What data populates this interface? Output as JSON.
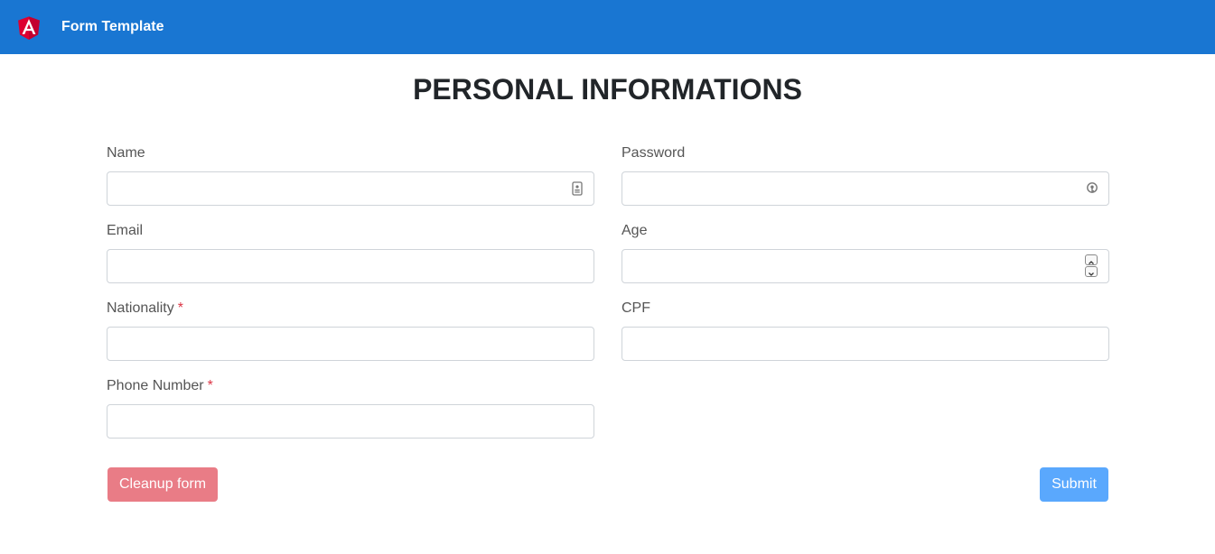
{
  "navbar": {
    "brand": "Form Template",
    "logo_icon": "angular-logo-icon",
    "background_color": "#1976d2"
  },
  "page": {
    "title": "PERSONAL INFORMATIONS"
  },
  "form": {
    "fields": {
      "name": {
        "label": "Name",
        "value": "",
        "required": false,
        "icon": "contact-card-icon"
      },
      "password": {
        "label": "Password",
        "value": "",
        "required": false,
        "icon": "key-icon"
      },
      "email": {
        "label": "Email",
        "value": "",
        "required": false
      },
      "age": {
        "label": "Age",
        "value": "",
        "required": false,
        "icon": "number-stepper-icon"
      },
      "nationality": {
        "label": "Nationality",
        "value": "",
        "required": true
      },
      "cpf": {
        "label": "CPF",
        "value": "",
        "required": false
      },
      "phone": {
        "label": "Phone Number",
        "value": "",
        "required": true
      }
    },
    "required_marker": "*",
    "buttons": {
      "cleanup": "Cleanup form",
      "submit": "Submit"
    }
  },
  "colors": {
    "danger": "#e97c86",
    "primary": "#5aa8fd",
    "required": "#dc3545"
  }
}
